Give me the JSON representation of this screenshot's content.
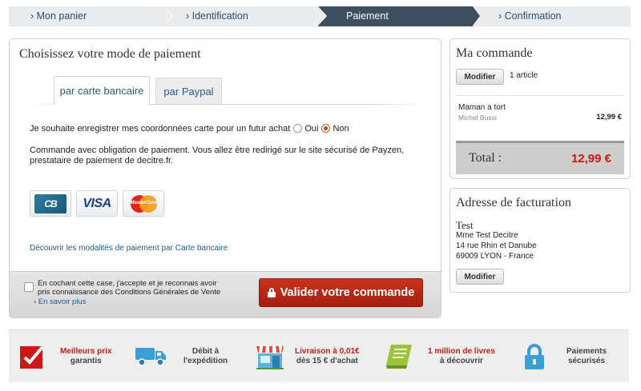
{
  "steps": [
    {
      "label": "› Mon panier",
      "active": false
    },
    {
      "label": "› Identification",
      "active": false
    },
    {
      "label": "Paiement",
      "active": true
    },
    {
      "label": "› Confirmation",
      "active": false
    }
  ],
  "payment": {
    "title": "Choisissez votre mode de paiement",
    "tabs": [
      "par carte bancaire",
      "par Paypal"
    ],
    "save_question": "Je souhaite enregistrer mes coordonnées carte pour un futur achat",
    "save_yes": "Oui",
    "save_no": "Non",
    "notice": "Commande avec obligation de paiement. Vous allez être redirigé sur le site sécurisé de Payzen, prestataire de paiement de decitre.fr.",
    "cards": [
      {
        "name": "CB",
        "icon": "cb-card-icon"
      },
      {
        "name": "VISA",
        "icon": "visa-card-icon"
      },
      {
        "name": "MasterCard",
        "icon": "mastercard-card-icon"
      }
    ],
    "discover_link": "Découvrir les modalités de paiement par Carte bancaire",
    "cgv_text": "En cochant cette case, j'accepte et je reconnais avoir pris connaissance des Conditions Générales de Vente",
    "cgv_more": "› En savoir plus",
    "validate_label": "Valider votre commande"
  },
  "order": {
    "title": "Ma commande",
    "modify_label": "Modifier",
    "count": "1 article",
    "item_title": "Maman a tort",
    "item_author": "Michel Bussi",
    "item_price": "12,99 €",
    "total_label": "Total :",
    "total_value": "12,99 €"
  },
  "billing": {
    "title": "Adresse de facturation",
    "name": "Test",
    "lines": [
      "Mme Test Decitre",
      "14 rue Rhin et Danube",
      "69009 LYON - France"
    ],
    "modify_label": "Modifier"
  },
  "reassurance": [
    {
      "icon": "checkmark-icon",
      "highlight": "Meilleurs prix",
      "rest": "garantis"
    },
    {
      "icon": "delivery-truck-icon",
      "highlight": "",
      "rest1": "Débit à",
      "rest2": "l'expédition"
    },
    {
      "icon": "shop-icon",
      "highlight": "Livraison à 0,01€",
      "rest": "dès 15 € d'achat"
    },
    {
      "icon": "book-icon",
      "highlight": "1 million de livres",
      "rest": "à découvrir"
    },
    {
      "icon": "padlock-icon",
      "highlight": "",
      "rest1": "Paiements",
      "rest2": "sécurisés"
    }
  ],
  "colors": {
    "active_step": "#3e4f60",
    "accent_red": "#c9321c",
    "price_red": "#d0180e",
    "link_blue": "#1f5a8c"
  }
}
